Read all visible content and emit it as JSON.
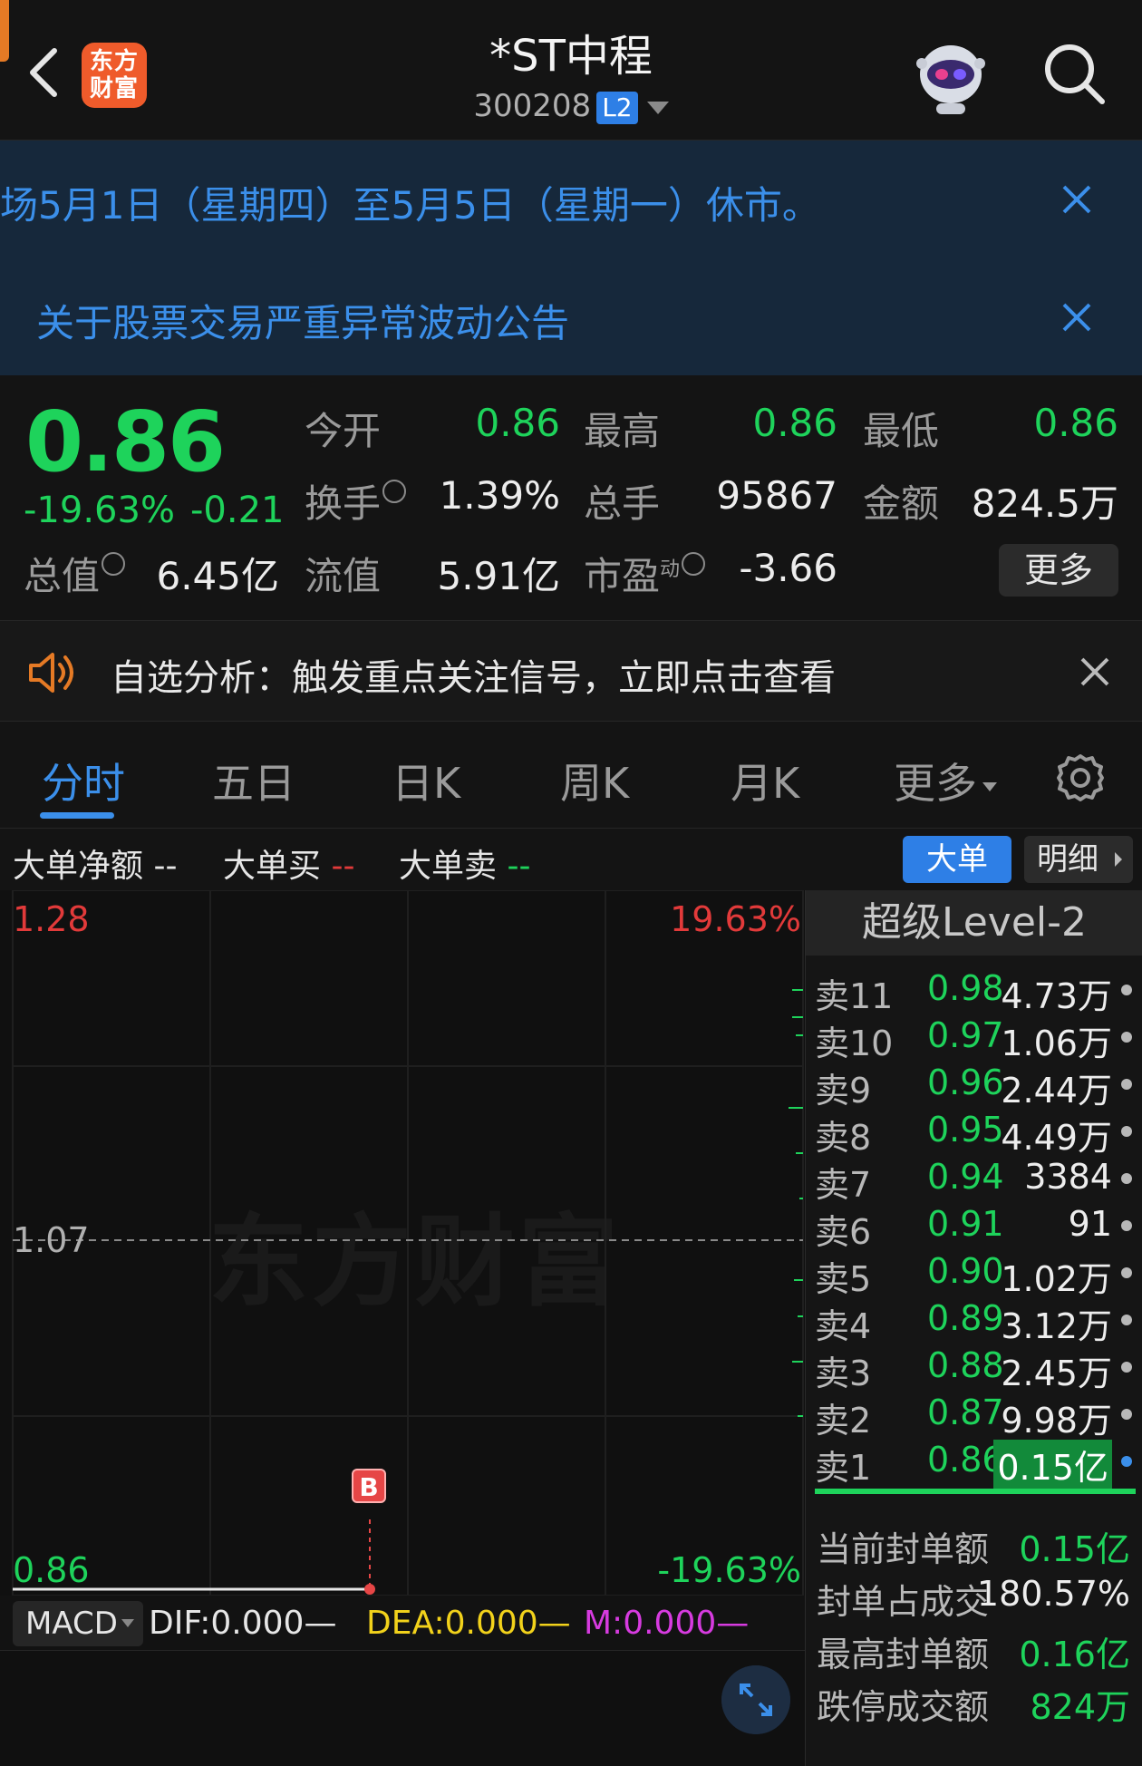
{
  "header": {
    "title": "*ST中程",
    "code": "300208",
    "level_badge": "L2",
    "logo_text_1": "东方",
    "logo_text_2": "财富"
  },
  "notices": [
    {
      "text": "场5月1日（星期四）至5月5日（星期一）休市。"
    },
    {
      "text": "关于股票交易严重异常波动公告"
    }
  ],
  "quote": {
    "price": "0.86",
    "change_pct": "-19.63%",
    "change": "-0.21",
    "open_label": "今开",
    "open": "0.86",
    "high_label": "最高",
    "high": "0.86",
    "low_label": "最低",
    "low": "0.86",
    "turnover_label": "换手",
    "turnover": "1.39%",
    "volume_label": "总手",
    "volume": "95867",
    "amount_label": "金额",
    "amount": "824.5万",
    "mktcap_label": "总值",
    "mktcap": "6.45亿",
    "float_label": "流值",
    "float": "5.91亿",
    "pe_label": "市盈",
    "pe_sup": "动",
    "pe": "-3.66",
    "more_label": "更多"
  },
  "analysis": {
    "text": "自选分析：触发重点关注信号，立即点击查看"
  },
  "tabs": [
    {
      "label": "分时",
      "active": true
    },
    {
      "label": "五日"
    },
    {
      "label": "日K"
    },
    {
      "label": "周K"
    },
    {
      "label": "月K"
    },
    {
      "label": "更多"
    }
  ],
  "bigorder": {
    "net_label": "大单净额",
    "net_value": "--",
    "buy_label": "大单买",
    "buy_value": "--",
    "sell_label": "大单卖",
    "sell_value": "--",
    "btn_big": "大单",
    "btn_detail": "明细"
  },
  "chart": {
    "watermark": "东方财富",
    "y_top": "1.28",
    "y_mid": "1.07",
    "y_bottom": "0.86",
    "pct_top": "19.63%",
    "pct_bottom": "-19.63%",
    "marker": "B"
  },
  "macd": {
    "select": "MACD",
    "dif": "DIF:0.000—",
    "dea": "DEA:0.000—",
    "m": "M:0.000—"
  },
  "orderbook": {
    "title": "超级Level-2",
    "rows": [
      {
        "label": "卖11",
        "price": "0.98",
        "vol": "4.73万"
      },
      {
        "label": "卖10",
        "price": "0.97",
        "vol": "1.06万"
      },
      {
        "label": "卖9",
        "price": "0.96",
        "vol": "2.44万"
      },
      {
        "label": "卖8",
        "price": "0.95",
        "vol": "4.49万"
      },
      {
        "label": "卖7",
        "price": "0.94",
        "vol": "3384"
      },
      {
        "label": "卖6",
        "price": "0.91",
        "vol": "91"
      },
      {
        "label": "卖5",
        "price": "0.90",
        "vol": "1.02万"
      },
      {
        "label": "卖4",
        "price": "0.89",
        "vol": "3.12万"
      },
      {
        "label": "卖3",
        "price": "0.88",
        "vol": "2.45万"
      },
      {
        "label": "卖2",
        "price": "0.87",
        "vol": "9.98万"
      },
      {
        "label": "卖1",
        "price": "0.86",
        "vol": "0.15亿"
      }
    ],
    "stats": [
      {
        "label": "当前封单额",
        "value": "0.15亿"
      },
      {
        "label": "封单占成交",
        "value": "180.57%"
      },
      {
        "label": "最高封单额",
        "value": "0.16亿"
      },
      {
        "label": "跌停成交额",
        "value": "824万"
      }
    ]
  },
  "colors": {
    "down": "#1ed35b",
    "up": "#e23a3a",
    "accent": "#3b8fea",
    "notice_bg": "#16283b"
  }
}
